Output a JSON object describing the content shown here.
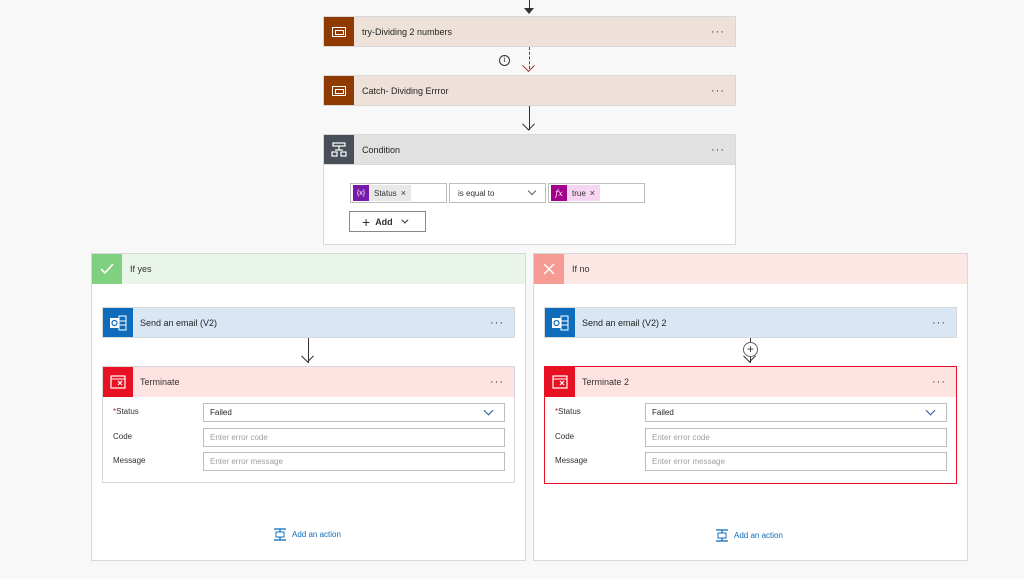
{
  "scope_try": {
    "title": "try-Dividing 2 numbers",
    "more": "···",
    "color": "#8e3a00"
  },
  "scope_catch": {
    "title": "Catch- Dividing Errror",
    "more": "···",
    "color": "#8e3a00"
  },
  "info_glyph": "i",
  "condition": {
    "title": "Condition",
    "more": "···",
    "left_token": {
      "icon": "{x}",
      "label": "Status",
      "remove": "×"
    },
    "operator": "is equal to",
    "right_token": {
      "icon": "fx",
      "label": "true",
      "remove": "×"
    },
    "add_label": "Add"
  },
  "branch_yes": {
    "label": "If yes",
    "email_action": {
      "title": "Send an email (V2)",
      "more": "···"
    },
    "terminate": {
      "title": "Terminate",
      "more": "···",
      "status_label": "Status",
      "status_value": "Failed",
      "code_label": "Code",
      "code_placeholder": "Enter error code",
      "message_label": "Message",
      "message_placeholder": "Enter error message"
    },
    "add_action": "Add an action"
  },
  "branch_no": {
    "label": "If no",
    "email_action": {
      "title": "Send an email (V2) 2",
      "more": "···"
    },
    "terminate": {
      "title": "Terminate 2",
      "more": "···",
      "status_label": "Status",
      "status_value": "Failed",
      "code_label": "Code",
      "code_placeholder": "Enter error code",
      "message_label": "Message",
      "message_placeholder": "Enter error message"
    },
    "add_action": "Add an action"
  },
  "required_mark": "*",
  "colors": {
    "scope_icon": "#8e3a00",
    "condition_icon": "#484f58",
    "yes_green": "#7fd07f",
    "no_red": "#f59b93",
    "outlook_blue": "#0f6cbd",
    "terminate_red": "#e81123",
    "variable_purple": "#7719aa",
    "expression_magenta": "#a4008e"
  }
}
